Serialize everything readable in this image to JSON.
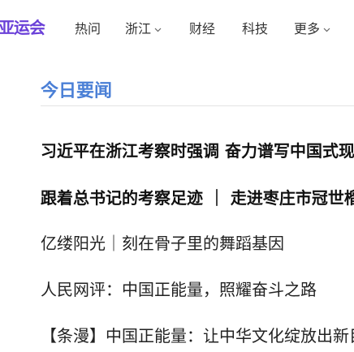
{
  "nav": {
    "logo": "亚运会",
    "items": [
      {
        "label": "热问",
        "dropdown": false
      },
      {
        "label": "浙江",
        "dropdown": true
      },
      {
        "label": "财经",
        "dropdown": false
      },
      {
        "label": "科技",
        "dropdown": false
      },
      {
        "label": "更多",
        "dropdown": true
      }
    ]
  },
  "section": {
    "title": "今日要闻"
  },
  "news": [
    {
      "title": "习近平在浙江考察时强调 奋力谱写中国式现",
      "bold": true
    },
    {
      "title": "跟着总书记的考察足迹 ｜ 走进枣庄市冠世榴",
      "bold": true
    },
    {
      "title": "亿缕阳光｜刻在骨子里的舞蹈基因",
      "bold": false
    },
    {
      "title": "人民网评：中国正能量，照耀奋斗之路",
      "bold": false
    },
    {
      "title": "【条漫】中国正能量：让中华文化绽放出新目",
      "bold": false
    }
  ],
  "colors": {
    "logo": "#6a40d8",
    "section_title": "#4a7fd6",
    "text": "#222222"
  }
}
